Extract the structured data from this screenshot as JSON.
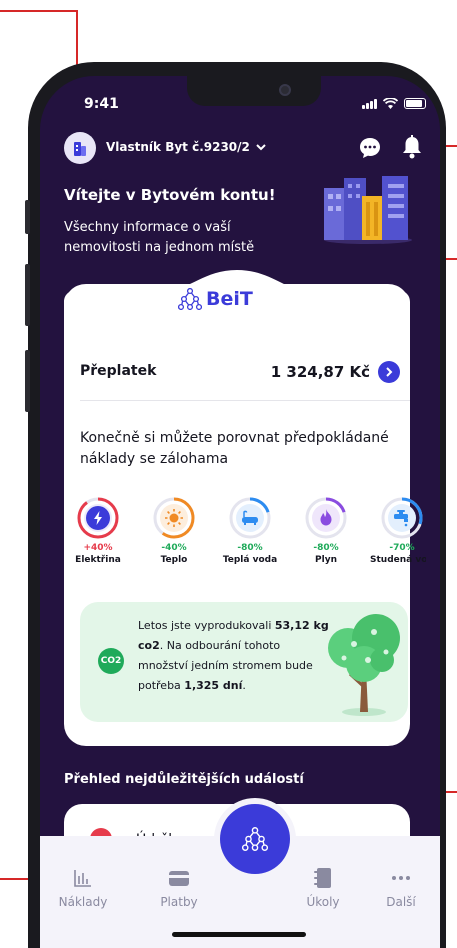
{
  "status_bar": {
    "time": "9:41"
  },
  "header": {
    "owner_label": "Vlastník Byt č.9230/2"
  },
  "hero": {
    "title": "Vítejte v Bytovém kontu!",
    "text": "Všechny informace o vaší nemovitosti na jednom místě"
  },
  "card": {
    "logo_text": "BeiT",
    "balance_label": "Přeplatek",
    "balance_value": "1 324,87 Kč",
    "compare_text": "Konečně si můžete porovnat předpokládané náklady se zálohama",
    "utilities": [
      {
        "name": "Elektřina",
        "change": "+40%",
        "level": 0.9,
        "color": "#e63b4b",
        "icon": "lightning-icon"
      },
      {
        "name": "Teplo",
        "change": "-40%",
        "level": 0.6,
        "color": "#f08a24",
        "icon": "sun-icon"
      },
      {
        "name": "Teplá voda",
        "change": "-80%",
        "level": 0.2,
        "color": "#2d8cf0",
        "icon": "bathtub-icon"
      },
      {
        "name": "Plyn",
        "change": "-80%",
        "level": 0.2,
        "color": "#8a4ce0",
        "icon": "flame-icon"
      },
      {
        "name": "Studená voda",
        "change": "-70%",
        "level": 0.3,
        "color": "#2d8cf0",
        "icon": "faucet-icon"
      }
    ],
    "eco": {
      "badge": "CO2",
      "text_1": "Letos jste vyprodukovali ",
      "amount": "53,12 kg co2",
      "text_2": ". Na odbourání tohoto množství jedním stromem bude potřeba ",
      "days": "1,325 dní",
      "text_3": "."
    }
  },
  "events": {
    "title": "Přehled nejdůležitějších událostí",
    "first_item": "Údržba"
  },
  "tabbar": {
    "items": [
      {
        "label": "Náklady",
        "icon": "chart-icon"
      },
      {
        "label": "Platby",
        "icon": "wallet-icon"
      },
      {
        "label": "Úkoly",
        "icon": "notebook-icon"
      },
      {
        "label": "Další",
        "icon": "more-icon"
      }
    ]
  },
  "colors": {
    "background": "#23123f",
    "accent": "#3b3bd9",
    "eco_bg": "#e3f6e8",
    "positive": "#1faa5a",
    "negative": "#e63b4b"
  }
}
